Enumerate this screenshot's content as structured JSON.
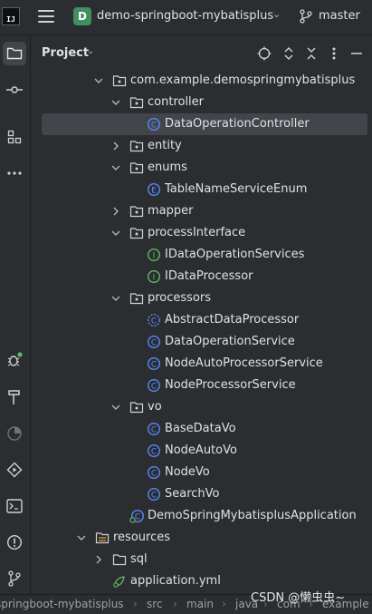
{
  "titlebar": {
    "logo_text": "IJ",
    "project_badge": "D",
    "project_name": "demo-springboot-mybatisplus",
    "branch": "master"
  },
  "sidebar_icons": [
    "folder-icon",
    "commit-icon",
    "structure-icon",
    "more-icon",
    "debug-icon",
    "build-icon",
    "profiler-icon",
    "services-icon",
    "terminal-icon",
    "problems-icon",
    "git-icon"
  ],
  "panel": {
    "title": "Project",
    "actions": [
      "locate-icon",
      "expand-all-icon",
      "collapse-all-icon",
      "options-icon",
      "hide-icon"
    ]
  },
  "tree": [
    {
      "label": "com.example.demospringmybatisplus",
      "kind": "package",
      "depth": 0,
      "expanded": true
    },
    {
      "label": "controller",
      "kind": "package",
      "depth": 1,
      "expanded": true
    },
    {
      "label": "DataOperationController",
      "kind": "class",
      "depth": 2,
      "selected": true
    },
    {
      "label": "entity",
      "kind": "package",
      "depth": 1,
      "expanded": false
    },
    {
      "label": "enums",
      "kind": "package",
      "depth": 1,
      "expanded": true
    },
    {
      "label": "TableNameServiceEnum",
      "kind": "enum",
      "depth": 2
    },
    {
      "label": "mapper",
      "kind": "package",
      "depth": 1,
      "expanded": false
    },
    {
      "label": "processInterface",
      "kind": "package",
      "depth": 1,
      "expanded": true
    },
    {
      "label": "IDataOperationServices",
      "kind": "interface",
      "depth": 2
    },
    {
      "label": "IDataProcessor",
      "kind": "interface",
      "depth": 2
    },
    {
      "label": "processors",
      "kind": "package",
      "depth": 1,
      "expanded": true
    },
    {
      "label": "AbstractDataProcessor",
      "kind": "abstract",
      "depth": 2
    },
    {
      "label": "DataOperationService",
      "kind": "class",
      "depth": 2
    },
    {
      "label": "NodeAutoProcessorService",
      "kind": "class",
      "depth": 2
    },
    {
      "label": "NodeProcessorService",
      "kind": "class",
      "depth": 2
    },
    {
      "label": "vo",
      "kind": "package",
      "depth": 1,
      "expanded": true
    },
    {
      "label": "BaseDataVo",
      "kind": "class",
      "depth": 2
    },
    {
      "label": "NodeAutoVo",
      "kind": "class",
      "depth": 2
    },
    {
      "label": "NodeVo",
      "kind": "class",
      "depth": 2
    },
    {
      "label": "SearchVo",
      "kind": "class",
      "depth": 2
    },
    {
      "label": "DemoSpringMybatisplusApplication",
      "kind": "springboot",
      "depth": 1
    },
    {
      "label": "resources",
      "kind": "resources",
      "depth": -1,
      "expanded": true
    },
    {
      "label": "sql",
      "kind": "folder",
      "depth": 0,
      "expanded": false
    },
    {
      "label": "application.yml",
      "kind": "yml",
      "depth": 0
    }
  ],
  "breadcrumb": [
    "springboot-mybatisplus",
    "src",
    "main",
    "java",
    "com",
    "example"
  ],
  "watermark": "CSDN @懒虫虫~",
  "colors": {
    "background": "#2b2d30",
    "selection": "#43454a",
    "class_icon": "#548af7",
    "interface_icon": "#5fb865",
    "project_badge": "#3f8f5f"
  }
}
